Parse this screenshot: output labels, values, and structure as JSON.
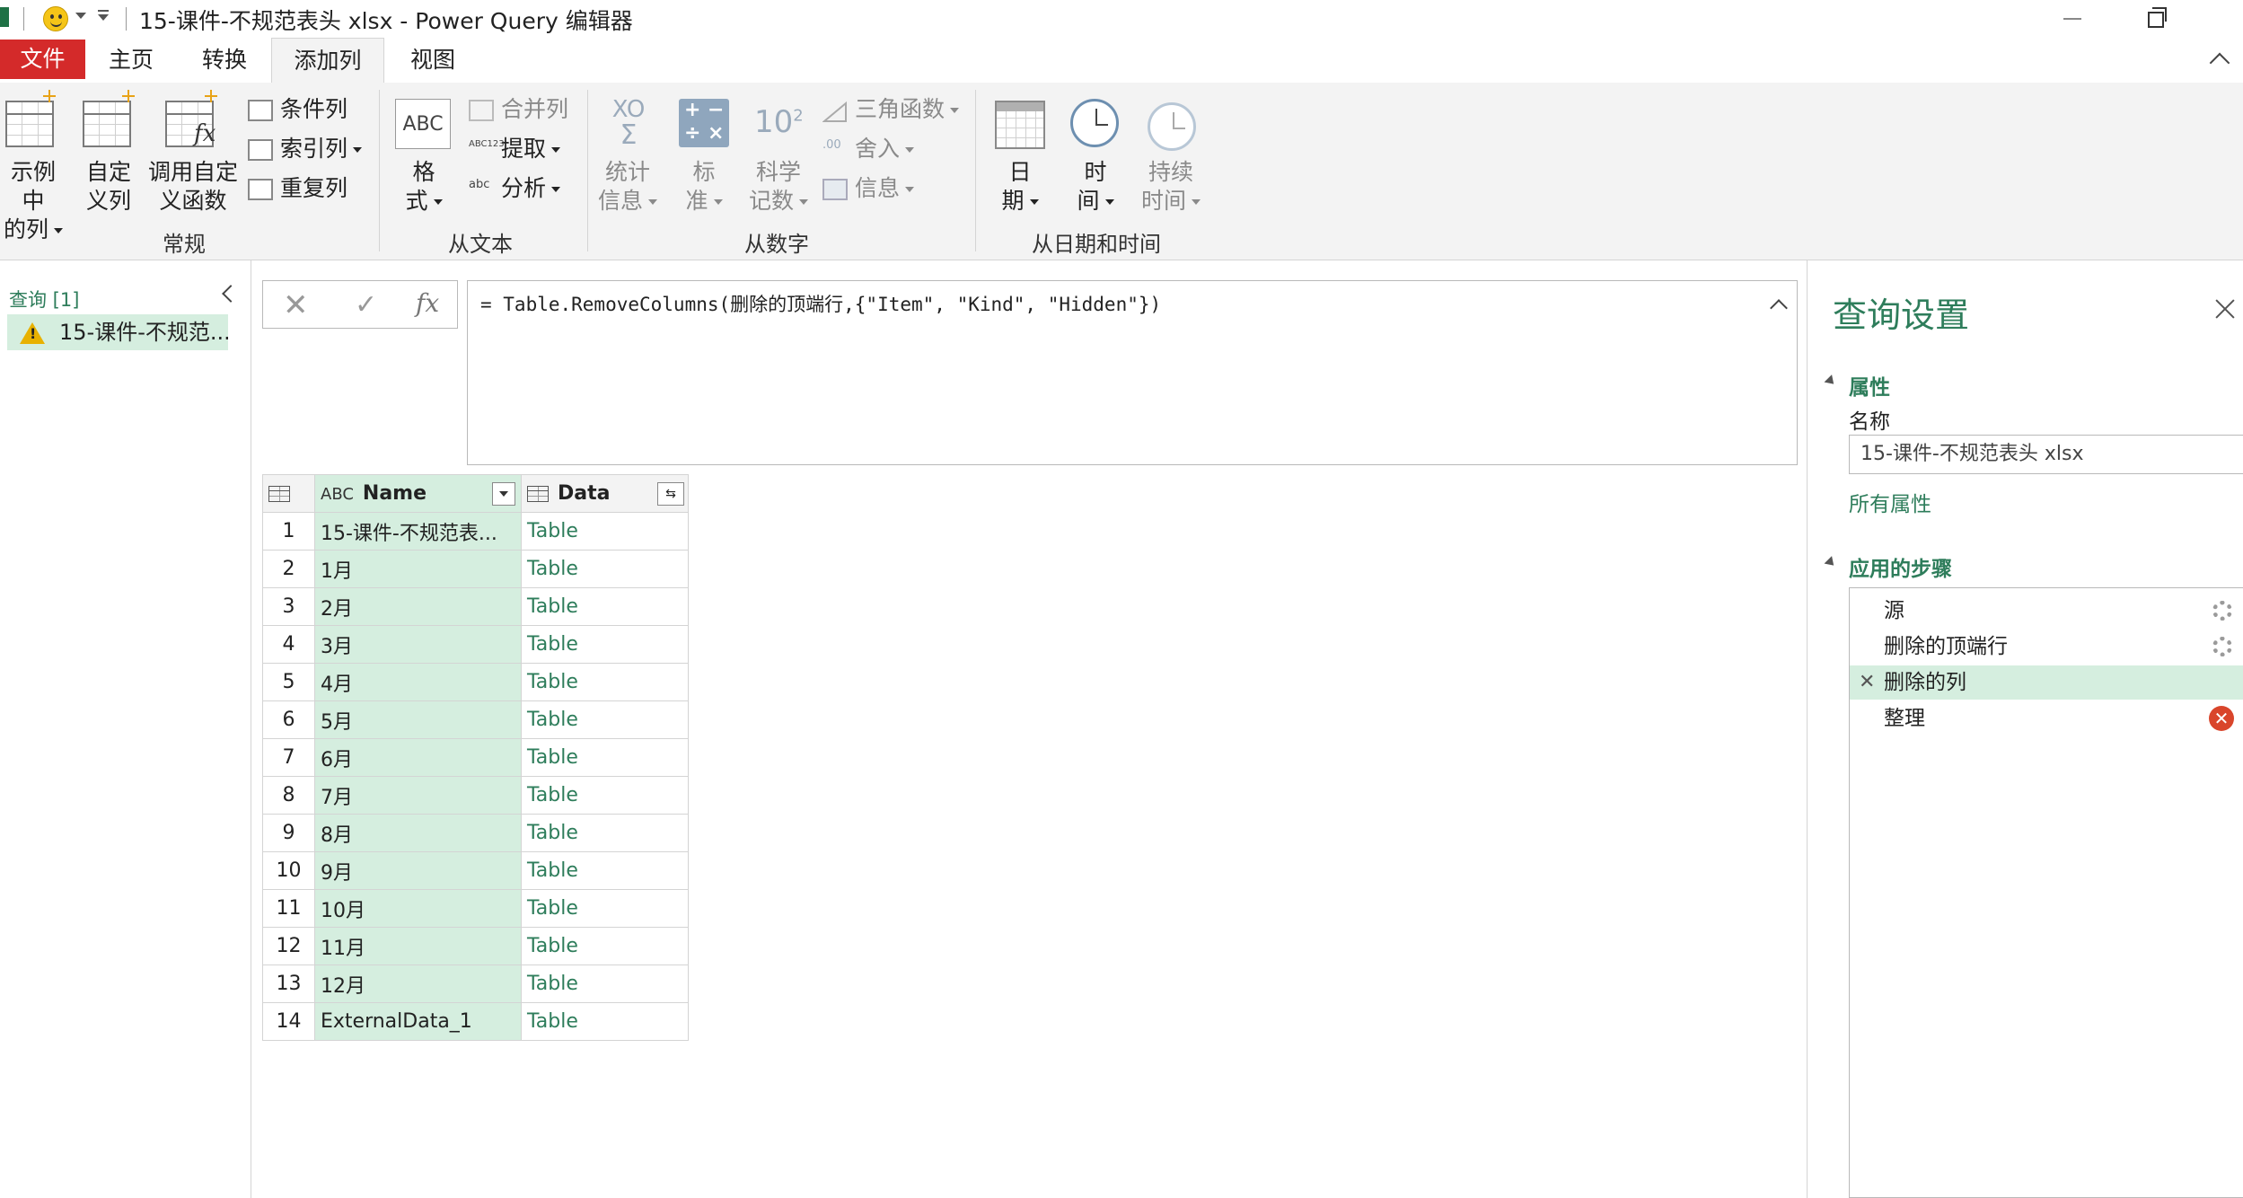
{
  "window": {
    "title": "15-课件-不规范表头 xlsx - Power Query 编辑器"
  },
  "menu": {
    "file": "文件",
    "tabs": [
      "主页",
      "转换",
      "添加列",
      "视图"
    ],
    "active_tab": "添加列"
  },
  "ribbon": {
    "general": {
      "label": "常规",
      "column_from_examples": [
        "示例中",
        "的列"
      ],
      "custom_column": [
        "自定",
        "义列"
      ],
      "invoke_custom_function": [
        "调用自定",
        "义函数"
      ],
      "conditional_column": "条件列",
      "index_column": "索引列",
      "duplicate_column": "重复列"
    },
    "from_text": {
      "label": "从文本",
      "format": [
        "格",
        "式"
      ],
      "merge_columns": "合并列",
      "extract": "提取",
      "parse": "分析"
    },
    "from_number": {
      "label": "从数字",
      "statistics": [
        "统计",
        "信息"
      ],
      "standard": [
        "标",
        "准"
      ],
      "scientific": [
        "科学",
        "记数"
      ],
      "trigonometry": "三角函数",
      "rounding": "舍入",
      "information": "信息",
      "calc_glyphs": [
        "+",
        "−",
        "÷",
        "×"
      ],
      "scientific_glyph": "10",
      "scientific_sup": "2",
      "xo_glyph": "XO",
      "sigma_glyph": "Σ",
      "abc_glyph": "ABC",
      "abc123_glyph": "ABC123",
      "abc_small": "abc",
      "round_glyph": ".00"
    },
    "from_datetime": {
      "label": "从日期和时间",
      "date": [
        "日",
        "期"
      ],
      "time": [
        "时",
        "间"
      ],
      "duration": [
        "持续",
        "时间"
      ]
    }
  },
  "queries": {
    "title": "查询 [1]",
    "items": [
      "15-课件-不规范..."
    ]
  },
  "formula_bar": {
    "cancel_glyph": "✕",
    "commit_glyph": "✓",
    "fx_glyph": "fx",
    "formula": "= Table.RemoveColumns(删除的顶端行,{\"Item\", \"Kind\", \"Hidden\"})"
  },
  "table": {
    "type_glyph": "ABC",
    "expand_glyph": "⇆",
    "columns": [
      "Name",
      "Data"
    ],
    "rows": [
      {
        "n": "1",
        "name": "15-课件-不规范表...",
        "data": "Table"
      },
      {
        "n": "2",
        "name": "1月",
        "data": "Table"
      },
      {
        "n": "3",
        "name": "2月",
        "data": "Table"
      },
      {
        "n": "4",
        "name": "3月",
        "data": "Table"
      },
      {
        "n": "5",
        "name": "4月",
        "data": "Table"
      },
      {
        "n": "6",
        "name": "5月",
        "data": "Table"
      },
      {
        "n": "7",
        "name": "6月",
        "data": "Table"
      },
      {
        "n": "8",
        "name": "7月",
        "data": "Table"
      },
      {
        "n": "9",
        "name": "8月",
        "data": "Table"
      },
      {
        "n": "10",
        "name": "9月",
        "data": "Table"
      },
      {
        "n": "11",
        "name": "10月",
        "data": "Table"
      },
      {
        "n": "12",
        "name": "11月",
        "data": "Table"
      },
      {
        "n": "13",
        "name": "12月",
        "data": "Table"
      },
      {
        "n": "14",
        "name": "ExternalData_1",
        "data": "Table"
      }
    ]
  },
  "settings": {
    "title": "查询设置",
    "properties_label": "属性",
    "name_label": "名称",
    "name_value": "15-课件-不规范表头 xlsx",
    "all_properties": "所有属性",
    "applied_steps_label": "应用的步骤",
    "steps": [
      {
        "label": "源",
        "icon": "gear-icon"
      },
      {
        "label": "删除的顶端行",
        "icon": "gear-icon"
      },
      {
        "label": "删除的列",
        "icon": "delete-step-icon",
        "selected": true
      },
      {
        "label": "整理",
        "icon": "error-icon"
      }
    ],
    "delete_glyph": "✕",
    "error_glyph": "✕"
  },
  "colors": {
    "accent_green": "#2e7d5b",
    "selection_green": "#d5eedf",
    "file_tab_red": "#d42a2a",
    "error_red": "#d9452b"
  }
}
